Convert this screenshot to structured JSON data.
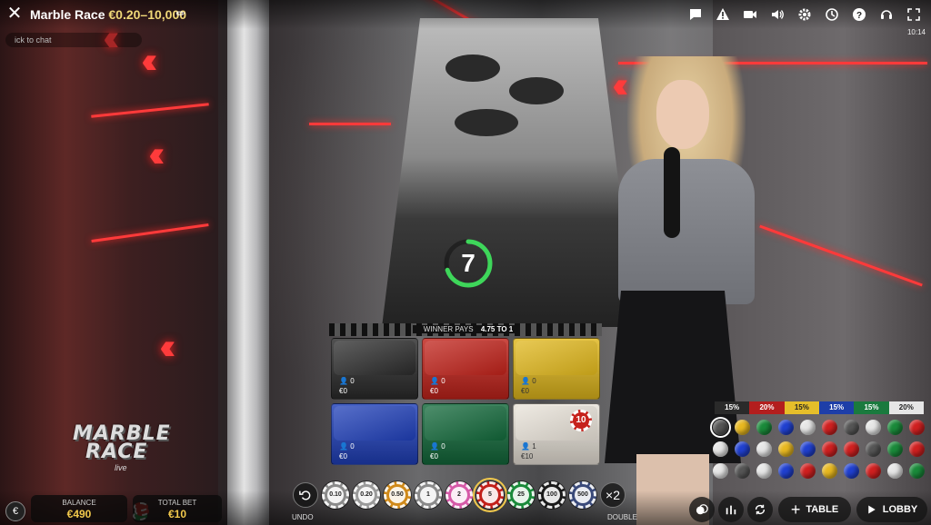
{
  "header": {
    "title": "Marble Race",
    "limits": "€0.20–10,000",
    "chat_placeholder": "ick to chat",
    "time": "10:14",
    "icons": [
      "chat-icon",
      "warning-icon",
      "video-icon",
      "volume-icon",
      "gear-icon",
      "history-icon",
      "help-icon",
      "headset-icon",
      "fullscreen-icon"
    ]
  },
  "timer": {
    "value": "7",
    "progress": 0.7
  },
  "bet_panel": {
    "banner_prefix": "WINNER PAYS",
    "banner_odds": "4.75 TO 1",
    "cells": [
      {
        "color": "#2b2b2b",
        "players": "0",
        "amount": "€0",
        "light": false,
        "chip": ""
      },
      {
        "color": "#c0221a",
        "players": "0",
        "amount": "€0",
        "light": false,
        "chip": ""
      },
      {
        "color": "#e0b71c",
        "players": "0",
        "amount": "€0",
        "light": true,
        "chip": ""
      },
      {
        "color": "#1f3fb8",
        "players": "0",
        "amount": "€0",
        "light": false,
        "chip": ""
      },
      {
        "color": "#12683a",
        "players": "0",
        "amount": "€0",
        "light": false,
        "chip": ""
      },
      {
        "color": "#e8e2d8",
        "players": "1",
        "amount": "€10",
        "light": true,
        "chip": "10"
      }
    ]
  },
  "stats": {
    "segments": [
      {
        "label": "15%",
        "color": "#2a2a2a",
        "text": "#ffffff"
      },
      {
        "label": "20%",
        "color": "#b31e1e",
        "text": "#ffffff"
      },
      {
        "label": "15%",
        "color": "#e5be2a",
        "text": "#222222"
      },
      {
        "label": "15%",
        "color": "#1e3ea8",
        "text": "#ffffff"
      },
      {
        "label": "15%",
        "color": "#1a7a3e",
        "text": "#ffffff"
      },
      {
        "label": "20%",
        "color": "#e6e6e6",
        "text": "#222222"
      }
    ],
    "marbles": [
      "#555555",
      "#e8b820",
      "#1a8a3a",
      "#2040d0",
      "#e6e6e6",
      "#d02020",
      "#555555",
      "#e6e6e6",
      "#1a8a3a",
      "#d02020",
      "#e6e6e6",
      "#2040d0",
      "#e6e6e6",
      "#e8b820",
      "#2040d0",
      "#d02020",
      "#d02020",
      "#555555",
      "#1a8a3a",
      "#d02020",
      "#e6e6e6",
      "#555555",
      "#e6e6e6",
      "#2040d0",
      "#d02020",
      "#e8b820",
      "#2040d0",
      "#d02020",
      "#e6e6e6",
      "#1a8a3a"
    ]
  },
  "logo": {
    "line1": "MARBLE",
    "line2": "RACE",
    "sub": "live"
  },
  "footer": {
    "currency_symbol": "€",
    "balance_label": "BALANCE",
    "balance_value": "€490",
    "total_bet_label": "TOTAL BET",
    "total_bet_value": "€10",
    "undo_label": "UNDO",
    "double_label": "DOUBLE",
    "double_symbol": "×2",
    "table_label": "TABLE",
    "lobby_label": "LOBBY",
    "chips": [
      {
        "value": "0.10",
        "color": "#8a8a8a"
      },
      {
        "value": "0.20",
        "color": "#9a9a9a"
      },
      {
        "value": "0.50",
        "color": "#d08a1a"
      },
      {
        "value": "1",
        "color": "#8a8a8a"
      },
      {
        "value": "2",
        "color": "#d65aa8"
      },
      {
        "value": "5",
        "color": "#c2201a"
      },
      {
        "value": "25",
        "color": "#1a8a3a"
      },
      {
        "value": "100",
        "color": "#1a1a1a"
      },
      {
        "value": "500",
        "color": "#3a4a7a"
      }
    ],
    "selected_chip": 5
  }
}
